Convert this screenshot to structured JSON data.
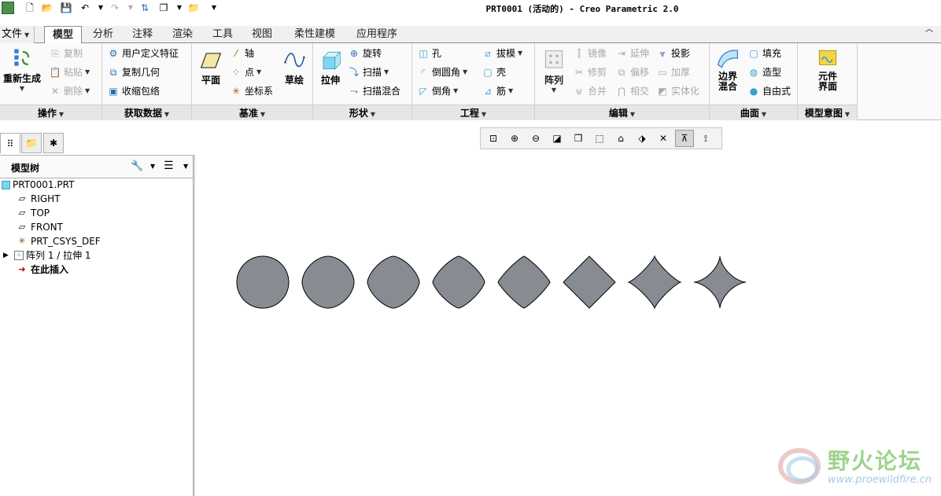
{
  "window": {
    "title": "PRT0001 (活动的) - Creo Parametric 2.0"
  },
  "file_tab": "文件",
  "tabs": [
    "模型",
    "分析",
    "注释",
    "渲染",
    "工具",
    "视图",
    "柔性建模",
    "应用程序"
  ],
  "ribbon": {
    "operations": {
      "label": "操作",
      "regenerate": "重新生成",
      "copy": "复制",
      "paste": "粘贴",
      "delete": "删除"
    },
    "get_data": {
      "label": "获取数据",
      "udf": "用户定义特征",
      "copy_geometry": "复制几何",
      "shrinkwrap": "收缩包络"
    },
    "datum": {
      "label": "基准",
      "plane": "平面",
      "axis": "轴",
      "point": "点",
      "csys": "坐标系",
      "sketch": "草绘"
    },
    "shapes": {
      "label": "形状",
      "extrude": "拉伸",
      "revolve": "旋转",
      "sweep": "扫描",
      "swept_blend": "扫描混合"
    },
    "engineering": {
      "label": "工程",
      "hole": "孔",
      "round": "倒圆角",
      "chamfer": "倒角",
      "draft": "拔模",
      "shell": "壳",
      "rib": "筋"
    },
    "editing": {
      "label": "编辑",
      "pattern": "阵列",
      "mirror": "镜像",
      "trim": "修剪",
      "merge": "合并",
      "extend": "延伸",
      "offset": "偏移",
      "intersect": "相交",
      "project": "投影",
      "thicken": "加厚",
      "solidify": "实体化"
    },
    "surfaces": {
      "label": "曲面",
      "boundary_blend": "边界混合",
      "fill": "填充",
      "style": "造型",
      "freestyle": "自由式"
    },
    "model_intent": {
      "label": "模型意图",
      "component_interface": "元件界面"
    }
  },
  "model_tree": {
    "title": "模型树",
    "items": [
      {
        "label": "PRT0001.PRT",
        "icon": "part-icon"
      },
      {
        "label": "RIGHT",
        "icon": "datum-plane-icon"
      },
      {
        "label": "TOP",
        "icon": "datum-plane-icon"
      },
      {
        "label": "FRONT",
        "icon": "datum-plane-icon"
      },
      {
        "label": "PRT_CSYS_DEF",
        "icon": "csys-icon"
      },
      {
        "label": "阵列 1 / 拉伸 1",
        "icon": "pattern-icon"
      },
      {
        "label": "在此插入",
        "icon": "insert-here-icon"
      }
    ]
  },
  "shapes": {
    "fill": "#878b92",
    "stroke": "#000000",
    "exponents": [
      1.0,
      0.88,
      0.76,
      0.66,
      0.58,
      0.5,
      0.42,
      0.33
    ]
  },
  "watermark": {
    "text": "野火论坛",
    "url": "www.proewildfire.cn"
  },
  "colors": {
    "accent": "#2b6cb0",
    "tab_bg": "#f0f0f0"
  }
}
